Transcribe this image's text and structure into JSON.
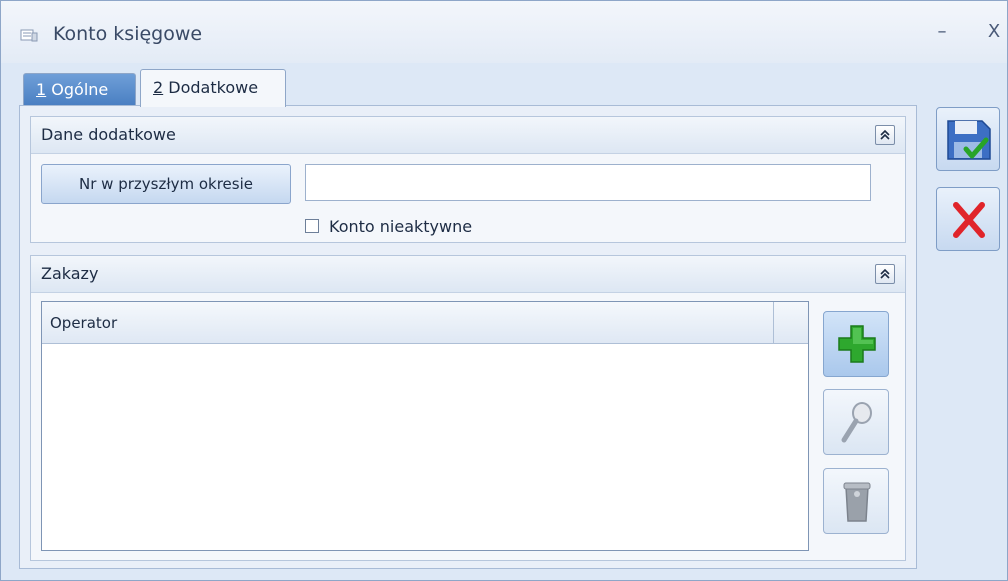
{
  "window": {
    "title": "Konto księgowe",
    "minimize_glyph": "–",
    "close_glyph": "X"
  },
  "tabs": [
    {
      "accel": "1",
      "label": " Ogólne",
      "active": false
    },
    {
      "accel": "2",
      "label": " Dodatkowe",
      "active": true
    }
  ],
  "dane": {
    "title": "Dane dodatkowe",
    "collapse_glyph": "⌃",
    "nr_button_label": "Nr w przyszłym okresie",
    "nr_value": "",
    "inactive_label": "Konto nieaktywne",
    "inactive_checked": false
  },
  "zakazy": {
    "title": "Zakazy",
    "collapse_glyph": "⌃",
    "columns": [
      "Operator",
      ""
    ],
    "rows": []
  },
  "icons": {
    "add": "plus-icon",
    "view": "magnifier-icon",
    "delete": "trash-icon",
    "save": "save-icon",
    "cancel": "cancel-icon"
  },
  "colors": {
    "accent": "#4a7fc2",
    "add_green": "#2ea82e",
    "cancel_red": "#e0242a"
  }
}
